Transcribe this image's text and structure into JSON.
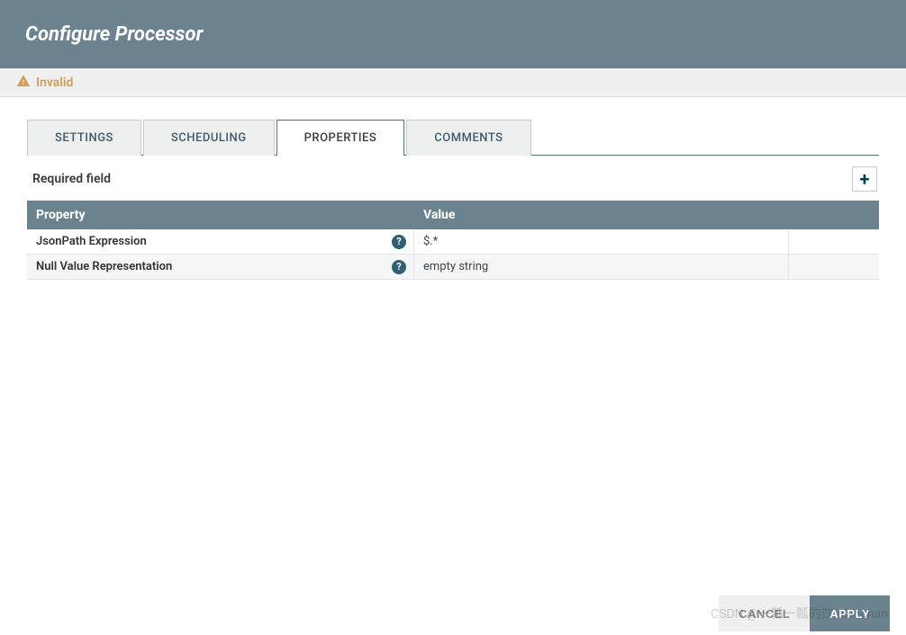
{
  "header": {
    "title": "Configure Processor"
  },
  "status": {
    "text": "Invalid"
  },
  "tabs": {
    "settings": "SETTINGS",
    "scheduling": "SCHEDULING",
    "properties": "PROPERTIES",
    "comments": "COMMENTS",
    "active": "properties"
  },
  "required_label": "Required field",
  "table": {
    "headers": {
      "property": "Property",
      "value": "Value"
    },
    "rows": [
      {
        "property": "JsonPath Expression",
        "value": "$.*"
      },
      {
        "property": "Null Value Representation",
        "value": "empty string"
      }
    ]
  },
  "buttons": {
    "cancel": "CANCEL",
    "apply": "APPLY"
  },
  "watermark": "CSDN @一瓢一瓢的饮 alanchan"
}
